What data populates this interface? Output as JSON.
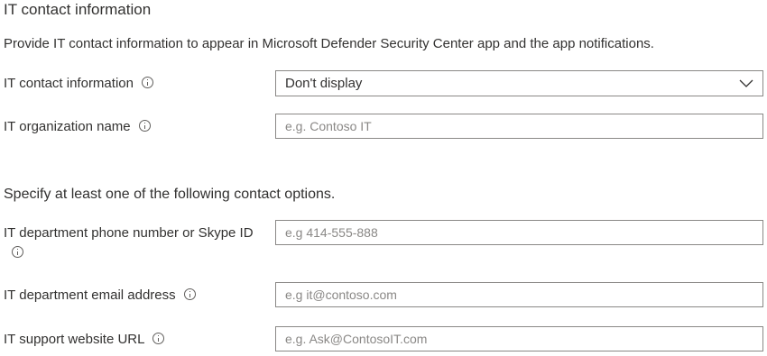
{
  "section": {
    "title": "IT contact information",
    "description": "Provide IT contact information to appear in Microsoft Defender Security Center app and the app notifications."
  },
  "fields": {
    "contact_info": {
      "label": "IT contact information",
      "value": "Don't display"
    },
    "org_name": {
      "label": "IT organization name",
      "placeholder": "e.g. Contoso IT",
      "value": ""
    }
  },
  "contact_options": {
    "heading": "Specify at least one of the following contact options.",
    "phone": {
      "label": "IT department phone number or Skype ID",
      "placeholder": "e.g 414-555-888",
      "value": ""
    },
    "email": {
      "label": "IT department email address",
      "placeholder": "e.g it@contoso.com",
      "value": ""
    },
    "website": {
      "label": "IT support website URL",
      "placeholder": "e.g. Ask@ContosoIT.com",
      "value": ""
    }
  },
  "icons": {
    "info": "info-circle-icon",
    "dropdown": "chevron-down-icon"
  }
}
